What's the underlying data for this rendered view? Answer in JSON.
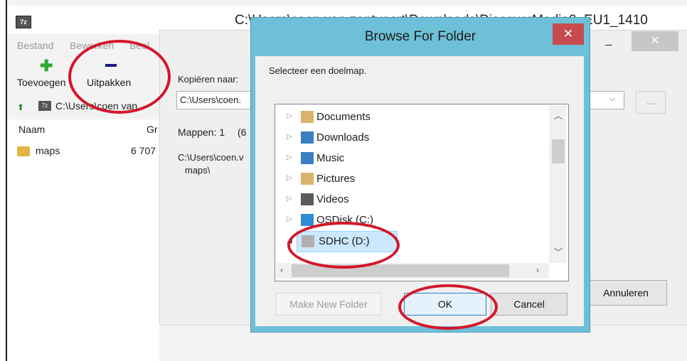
{
  "main_window": {
    "title": "C:\\Users\\coen van zantvoort\\Downloads\\DiscoverMedia2_EU1_1410",
    "app_icon_text": "7z",
    "menu": [
      "Bestand",
      "Bewerken",
      "Beel"
    ],
    "toolbar": {
      "add_label": "Toevoegen",
      "extract_label": "Uitpakken"
    },
    "path": "C:\\Users\\coen van..",
    "columns": [
      "Naam",
      "Gr"
    ],
    "files": [
      {
        "name": "maps",
        "size": "6 707"
      }
    ]
  },
  "extract_panel": {
    "copy_to_label": "Kopiëren naar:",
    "copy_to_value": "C:\\Users\\coen.",
    "folders_label": "Mappen: 1",
    "folders_extra": "(6",
    "path_line1": "C:\\Users\\coen.v",
    "path_line2": "maps\\",
    "browse_button": "...",
    "cancel_button": "Annuleren"
  },
  "dialog": {
    "title": "Browse For Folder",
    "close_glyph": "✕",
    "prompt": "Selecteer een doelmap.",
    "tree": [
      {
        "label": "Documents",
        "icon": "documents-folder-icon",
        "color": "#d9b36b"
      },
      {
        "label": "Downloads",
        "icon": "downloads-folder-icon",
        "color": "#3a7fc4"
      },
      {
        "label": "Music",
        "icon": "music-folder-icon",
        "color": "#3a7fc4"
      },
      {
        "label": "Pictures",
        "icon": "pictures-folder-icon",
        "color": "#d9b36b"
      },
      {
        "label": "Videos",
        "icon": "videos-folder-icon",
        "color": "#5b5b5b"
      },
      {
        "label": "OSDisk (C:)",
        "icon": "os-disk-icon",
        "color": "#2f8bd6"
      },
      {
        "label": "SDHC (D:)",
        "icon": "sd-card-icon",
        "color": "#b0b0b0"
      }
    ],
    "selected_item": "SDHC (D:)",
    "buttons": {
      "make_new_folder": "Make New Folder",
      "ok": "OK",
      "cancel": "Cancel"
    }
  },
  "accent_colors": {
    "annotation_red": "#d4162a",
    "dialog_frame": "#6dc0d7",
    "close_red": "#c74b50"
  }
}
